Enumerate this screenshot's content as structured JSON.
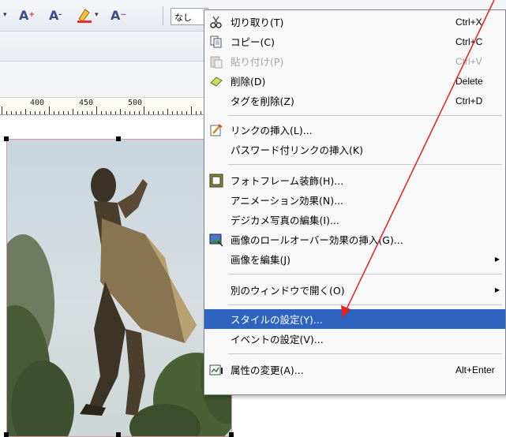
{
  "toolbar": {
    "font_increase_icon": "A+",
    "font_decrease_icon": "A-",
    "highlight_icon": "highlight-pen",
    "format_icon": "A",
    "style_dropdown_value": "なし"
  },
  "ruler": {
    "labels": [
      "400",
      "450",
      "500"
    ]
  },
  "context_menu": {
    "items": [
      {
        "label": "切り取り(T)",
        "shortcut": "Ctrl+X",
        "icon": "scissors-icon",
        "disabled": false
      },
      {
        "label": "コピー(C)",
        "shortcut": "Ctrl+C",
        "icon": "copy-icon",
        "disabled": false
      },
      {
        "label": "貼り付け(P)",
        "shortcut": "Ctrl+V",
        "icon": "paste-icon",
        "disabled": true
      },
      {
        "label": "削除(D)",
        "shortcut": "Delete",
        "icon": "eraser-icon",
        "disabled": false
      },
      {
        "label": "タグを削除(Z)",
        "shortcut": "Ctrl+D",
        "icon": "",
        "disabled": false
      },
      {
        "label": "リンクの挿入(L)...",
        "shortcut": "",
        "icon": "link-insert-icon",
        "disabled": false
      },
      {
        "label": "パスワード付リンクの挿入(K)",
        "shortcut": "",
        "icon": "",
        "disabled": false
      },
      {
        "label": "フォトフレーム装飾(H)...",
        "shortcut": "",
        "icon": "photo-frame-icon",
        "disabled": false
      },
      {
        "label": "アニメーション効果(N)...",
        "shortcut": "",
        "icon": "",
        "disabled": false
      },
      {
        "label": "デジカメ写真の編集(I)...",
        "shortcut": "",
        "icon": "",
        "disabled": false
      },
      {
        "label": "画像のロールオーバー効果の挿入(G)...",
        "shortcut": "",
        "icon": "rollover-image-icon",
        "disabled": false
      },
      {
        "label": "画像を編集(J)",
        "shortcut": "",
        "icon": "",
        "disabled": false,
        "submenu": true
      },
      {
        "label": "別のウィンドウで開く(O)",
        "shortcut": "",
        "icon": "",
        "disabled": false,
        "submenu": true
      },
      {
        "label": "スタイルの設定(Y)...",
        "shortcut": "",
        "icon": "",
        "disabled": false,
        "highlighted": true
      },
      {
        "label": "イベントの設定(V)...",
        "shortcut": "",
        "icon": "",
        "disabled": false
      },
      {
        "label": "属性の変更(A)...",
        "shortcut": "Alt+Enter",
        "icon": "properties-icon",
        "disabled": false
      }
    ]
  },
  "colors": {
    "menu_highlight": "#2e63c0",
    "annotation_arrow": "#e8201a"
  }
}
